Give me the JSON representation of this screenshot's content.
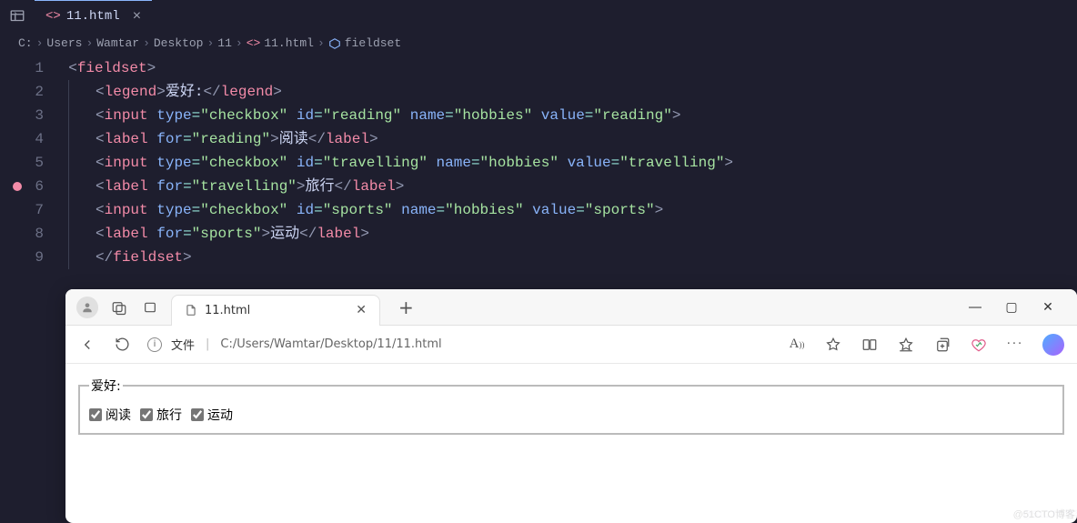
{
  "editor": {
    "tab": {
      "name": "11.html"
    },
    "breadcrumb": {
      "parts": [
        "C:",
        "Users",
        "Wamtar",
        "Desktop",
        "11",
        "11.html",
        "fieldset"
      ]
    },
    "lines": [
      {
        "n": 1,
        "breakpoint": false
      },
      {
        "n": 2,
        "breakpoint": false
      },
      {
        "n": 3,
        "breakpoint": false
      },
      {
        "n": 4,
        "breakpoint": false
      },
      {
        "n": 5,
        "breakpoint": false
      },
      {
        "n": 6,
        "breakpoint": true
      },
      {
        "n": 7,
        "breakpoint": false
      },
      {
        "n": 8,
        "breakpoint": false
      },
      {
        "n": 9,
        "breakpoint": false
      }
    ],
    "code": {
      "fieldset_open": "fieldset",
      "legend_tag": "legend",
      "legend_text": "爱好:",
      "input_tag": "input",
      "label_tag": "label",
      "attr_type": "type",
      "attr_id": "id",
      "attr_name": "name",
      "attr_value": "value",
      "attr_for": "for",
      "val_checkbox": "\"checkbox\"",
      "val_hobbies": "\"hobbies\"",
      "val_reading": "\"reading\"",
      "label_reading_text": "阅读",
      "val_travelling": "\"travelling\"",
      "label_travelling_text": "旅行",
      "val_sports": "\"sports\"",
      "label_sports_text": "运动",
      "fieldset_close": "fieldset"
    }
  },
  "browser": {
    "tab_title": "11.html",
    "url_label": "文件",
    "url_path": "C:/Users/Wamtar/Desktop/11/11.html",
    "page": {
      "legend": "爱好:",
      "options": [
        {
          "id": "reading",
          "label": "阅读",
          "checked": true
        },
        {
          "id": "travelling",
          "label": "旅行",
          "checked": true
        },
        {
          "id": "sports",
          "label": "运动",
          "checked": true
        }
      ]
    }
  },
  "watermark": "@51CTO博客"
}
